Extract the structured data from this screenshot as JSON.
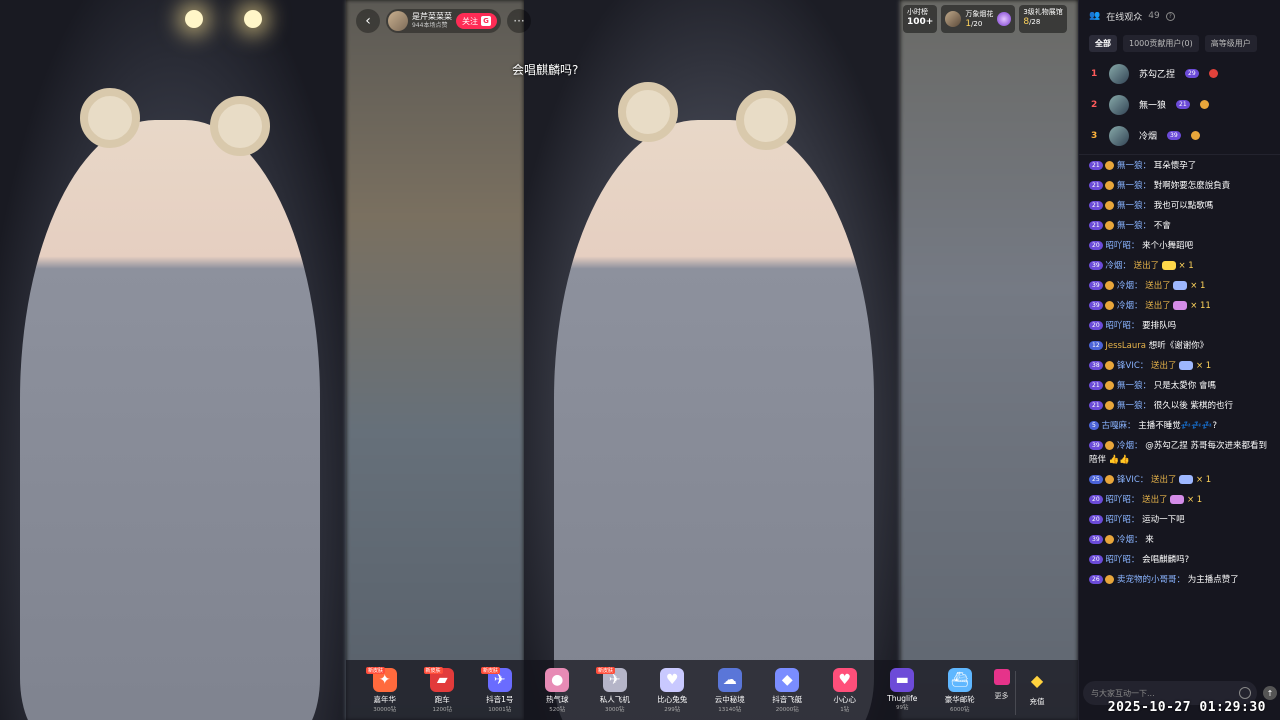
{
  "host": {
    "name": "是芹菜菜菜",
    "subtitle": "944本场点赞",
    "follow_label": "关注",
    "follow_badge": "G",
    "back_icon": "chevron-left-icon",
    "more_icon": "more-dots-icon"
  },
  "caption": "会唱麒麟吗?",
  "rank_badges": [
    {
      "title": "小时榜",
      "value": "100+"
    },
    {
      "title": "万象烟花",
      "value_a": "1",
      "value_b": "/20"
    },
    {
      "title": "3级礼物展馆",
      "value_a": "8",
      "value_b": "/28"
    }
  ],
  "gifts": [
    {
      "name": "嘉年华",
      "price": "30000钻",
      "badge": "新皮肤",
      "color": "#ff6a3d",
      "glyph": "✦"
    },
    {
      "name": "跑车",
      "price": "1200钻",
      "badge": "新皮肤",
      "color": "#e23b3b",
      "glyph": "▰"
    },
    {
      "name": "抖音1号",
      "price": "10001钻",
      "badge": "新皮肤",
      "color": "#6a6cff",
      "glyph": "✈"
    },
    {
      "name": "热气球",
      "price": "520钻",
      "badge": "",
      "color": "#e78bb5",
      "glyph": "●"
    },
    {
      "name": "私人飞机",
      "price": "3000钻",
      "badge": "新皮肤",
      "color": "#b5b5c8",
      "glyph": "✈"
    },
    {
      "name": "比心兔兔",
      "price": "299钻",
      "badge": "",
      "color": "#c9c9ff",
      "glyph": "♥"
    },
    {
      "name": "云中秘境",
      "price": "13140钻",
      "badge": "",
      "color": "#5a76d8",
      "glyph": "☁"
    },
    {
      "name": "抖音飞艇",
      "price": "20000钻",
      "badge": "",
      "color": "#7a8dff",
      "glyph": "◆"
    },
    {
      "name": "小心心",
      "price": "1钻",
      "badge": "",
      "color": "#ff4f7a",
      "glyph": "♥"
    },
    {
      "name": "Thuglife",
      "price": "99钻",
      "badge": "",
      "color": "#6d4bd8",
      "glyph": "▬"
    },
    {
      "name": "豪华邮轮",
      "price": "6000钻",
      "badge": "",
      "color": "#5fb7ff",
      "glyph": "⛴"
    }
  ],
  "gift_more_label": "更多",
  "recharge_label": "充值",
  "sidebar": {
    "title": "在线观众",
    "count": "49",
    "tabs": [
      "全部",
      "1000贡献用户(0)",
      "高等级用户"
    ],
    "top_users": [
      {
        "rank": "1",
        "name": "苏勾乙捏",
        "level": "29"
      },
      {
        "rank": "2",
        "name": "無一狼",
        "level": "21"
      },
      {
        "rank": "3",
        "name": "冷烟",
        "level": "39"
      }
    ],
    "messages": [
      {
        "level": "21",
        "fan": true,
        "name": "無一狼：",
        "text": "耳朵懷孕了"
      },
      {
        "level": "21",
        "fan": true,
        "name": "無一狼：",
        "text": "對啊妳要怎麼說負責"
      },
      {
        "level": "21",
        "fan": true,
        "name": "無一狼：",
        "text": "我也可以點歌嗎"
      },
      {
        "level": "21",
        "fan": true,
        "name": "無一狼：",
        "text": "不會"
      },
      {
        "level": "20",
        "fan": false,
        "name": "昭吖昭：",
        "text": "来个小舞蹈吧"
      },
      {
        "level": "39",
        "fan": false,
        "name": "冷烟：",
        "sent": "送出了",
        "gift": "yellow",
        "mult": "× 1"
      },
      {
        "level": "39",
        "fan": true,
        "name": "冷烟：",
        "sent": "送出了",
        "gift": "blue",
        "mult": "× 1"
      },
      {
        "level": "39",
        "fan": true,
        "name": "冷烟：",
        "sent": "送出了",
        "gift": "pink",
        "mult": "× 11"
      },
      {
        "level": "20",
        "fan": false,
        "name": "昭吖昭：",
        "text": "要排队吗"
      },
      {
        "level": "12",
        "fan": false,
        "name": "JessLaura",
        "text": "想听《谢谢你》",
        "gold": true
      },
      {
        "level": "38",
        "fan": true,
        "name": "锋VIC：",
        "sent": "送出了",
        "gift": "blue",
        "mult": "× 1"
      },
      {
        "level": "21",
        "fan": true,
        "name": "無一狼：",
        "text": "只是太愛你 會嗎"
      },
      {
        "level": "21",
        "fan": true,
        "name": "無一狼：",
        "text": "很久以後 紫棋的也行"
      },
      {
        "level": "5",
        "fan": false,
        "name": "古嘎麻：",
        "text": "主播不睡觉💤💤💤?"
      },
      {
        "level": "39",
        "fan": true,
        "name": "冷烟：",
        "text": "@苏勾乙捏 苏哥每次进来都看到陪伴 👍👍"
      },
      {
        "level": "25",
        "fan": true,
        "name": "锋VIC：",
        "sent": "送出了",
        "gift": "blue",
        "mult": "× 1"
      },
      {
        "level": "20",
        "fan": false,
        "name": "昭吖昭：",
        "sent": "送出了",
        "gift": "pink",
        "mult": "× 1"
      },
      {
        "level": "20",
        "fan": false,
        "name": "昭吖昭：",
        "text": "运动一下吧"
      },
      {
        "level": "39",
        "fan": true,
        "name": "冷烟：",
        "text": "来"
      },
      {
        "level": "20",
        "fan": false,
        "name": "昭吖昭：",
        "text": "会唱麒麟吗?"
      },
      {
        "level": "26",
        "fan": true,
        "name": "卖宠物的小哥哥：",
        "text": "为主播点赞了"
      }
    ],
    "input_placeholder": "与大家互动一下..."
  },
  "timestamp": "2025-10-27 01:29:30",
  "colors": {
    "accent": "#fe2c55",
    "gold": "#e6b34a",
    "level": "#6b4bd8"
  }
}
